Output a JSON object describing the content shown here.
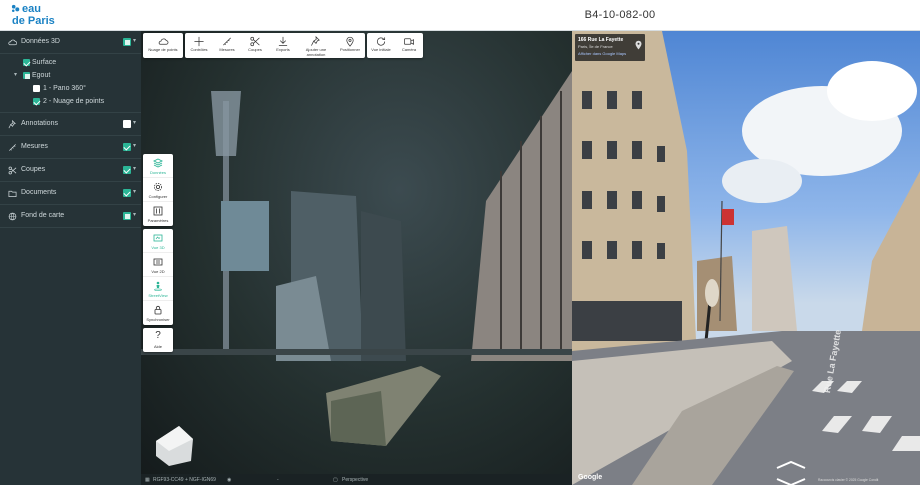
{
  "header": {
    "logo_line1": "eau",
    "logo_line2": "de Paris",
    "project_id": "B4-10-082-00"
  },
  "sidebar": {
    "sections": [
      {
        "label": "Données 3D",
        "icon": "cloud-icon",
        "checked": "mixed"
      },
      {
        "label": "Annotations",
        "icon": "pin-icon",
        "checked": "off"
      },
      {
        "label": "Mesures",
        "icon": "ruler-icon",
        "checked": "on"
      },
      {
        "label": "Coupes",
        "icon": "scissors-icon",
        "checked": "on"
      },
      {
        "label": "Documents",
        "icon": "folder-icon",
        "checked": "on"
      },
      {
        "label": "Fond de carte",
        "icon": "globe-icon",
        "checked": "mixed"
      }
    ],
    "tree": [
      {
        "label": "Surface",
        "checked": "on"
      },
      {
        "label": "Egout",
        "checked": "mixed"
      },
      {
        "label": "1 - Pano 360°",
        "checked": "off"
      },
      {
        "label": "2 - Nuage de points",
        "checked": "on"
      }
    ]
  },
  "toolbar": {
    "groups": [
      [
        {
          "label": "Nuage de points",
          "icon": "cloud-icon"
        }
      ],
      [
        {
          "label": "Contrôles",
          "icon": "move-icon"
        },
        {
          "label": "Mesures",
          "icon": "ruler-icon"
        },
        {
          "label": "Coupes",
          "icon": "scissors-icon"
        },
        {
          "label": "Exports",
          "icon": "download-icon"
        },
        {
          "label": "Ajouter une annotation",
          "icon": "pin-icon"
        },
        {
          "label": "Positionner",
          "icon": "location-icon"
        }
      ],
      [
        {
          "label": "Vue initiale",
          "icon": "refresh-icon"
        },
        {
          "label": "Caméra",
          "icon": "camera-icon"
        }
      ]
    ]
  },
  "side_tools": {
    "group1": [
      {
        "label": "Données",
        "icon": "layers-icon",
        "active": true
      },
      {
        "label": "Configurer",
        "icon": "gear-icon",
        "active": false
      },
      {
        "label": "Paramètres",
        "icon": "sliders-icon",
        "active": false
      }
    ],
    "group2": [
      {
        "label": "Vue 3D",
        "icon": "view3d-icon",
        "active": true
      },
      {
        "label": "Vue 2D",
        "icon": "view2d-icon",
        "active": false
      },
      {
        "label": "StreetView",
        "icon": "pegman-icon",
        "active": true
      },
      {
        "label": "Synchroniser",
        "icon": "lock-icon",
        "active": false
      }
    ],
    "group3": [
      {
        "label": "Aide",
        "icon": "help-icon",
        "active": false
      }
    ]
  },
  "statusbar": {
    "crs": "RGF93-CC49 + NGF-IGN69",
    "value": "-",
    "projection": "Perspective"
  },
  "streetview": {
    "address": "166 Rue La Fayette",
    "city": "Paris, Île de France",
    "maps_link": "Afficher dans Google Maps",
    "google": "Google",
    "attribution": "Raccourcis clavier  © 2025 Google  Condit",
    "street_marking": "Rue La Fayette"
  },
  "colors": {
    "accent": "#2bb596",
    "sidebar_bg": "#263337",
    "brand": "#1a82c4"
  }
}
